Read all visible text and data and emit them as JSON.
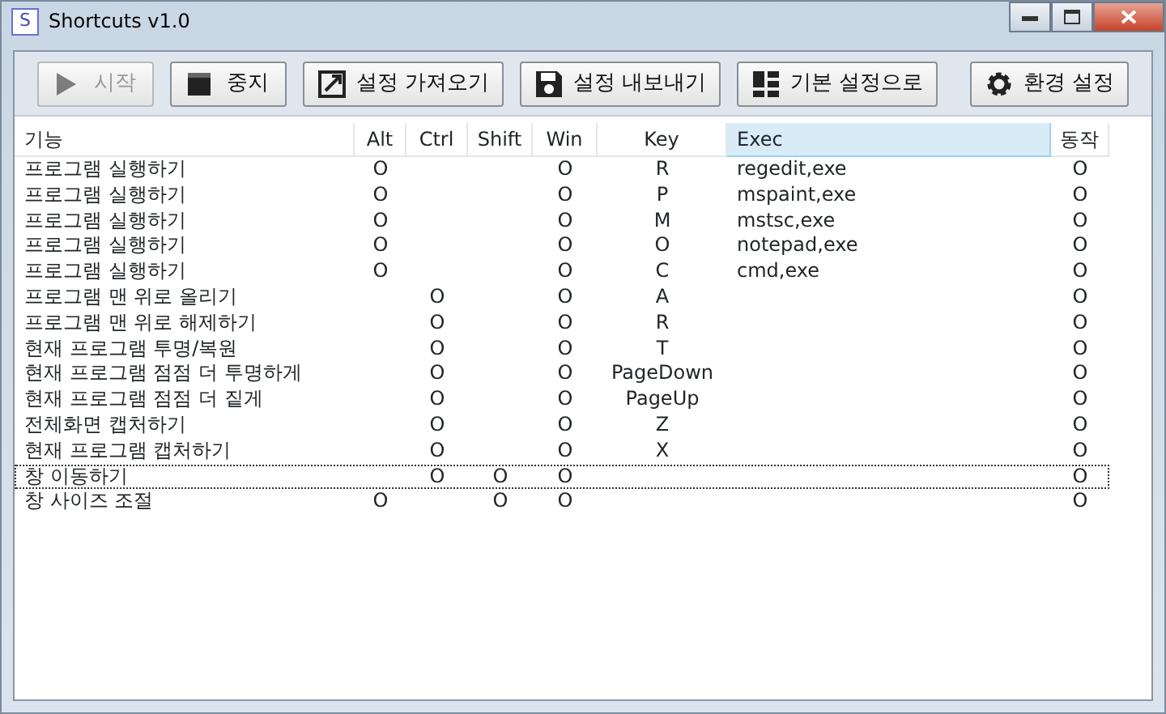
{
  "window": {
    "title": "Shortcuts v1.0",
    "icon_letter": "S"
  },
  "toolbar": [
    {
      "kind": "play",
      "label": "시작",
      "disabled": true
    },
    {
      "kind": "stop",
      "label": "중지",
      "disabled": false
    },
    {
      "kind": "import",
      "label": "설정 가져오기",
      "disabled": false
    },
    {
      "kind": "save",
      "label": "설정 내보내기",
      "disabled": false
    },
    {
      "kind": "grid",
      "label": "기본 설정으로",
      "disabled": false
    },
    {
      "kind": "gear",
      "label": "환경 설정",
      "disabled": false
    }
  ],
  "table": {
    "columns": [
      {
        "label": "기능",
        "highlighted": false
      },
      {
        "label": "Alt",
        "highlighted": false
      },
      {
        "label": "Ctrl",
        "highlighted": false
      },
      {
        "label": "Shift",
        "highlighted": false
      },
      {
        "label": "Win",
        "highlighted": false
      },
      {
        "label": "Key",
        "highlighted": false
      },
      {
        "label": "Exec",
        "highlighted": true
      },
      {
        "label": "동작",
        "highlighted": false
      }
    ],
    "rows": [
      {
        "cells": [
          "프로그램 실행하기",
          "O",
          "",
          "",
          "O",
          "R",
          "regedit,exe",
          "O"
        ],
        "selected": false
      },
      {
        "cells": [
          "프로그램 실행하기",
          "O",
          "",
          "",
          "O",
          "P",
          "mspaint,exe",
          "O"
        ],
        "selected": false
      },
      {
        "cells": [
          "프로그램 실행하기",
          "O",
          "",
          "",
          "O",
          "M",
          "mstsc,exe",
          "O"
        ],
        "selected": false
      },
      {
        "cells": [
          "프로그램 실행하기",
          "O",
          "",
          "",
          "O",
          "O",
          "notepad,exe",
          "O"
        ],
        "selected": false
      },
      {
        "cells": [
          "프로그램 실행하기",
          "O",
          "",
          "",
          "O",
          "C",
          "cmd,exe",
          "O"
        ],
        "selected": false
      },
      {
        "cells": [
          "프로그램 맨 위로 올리기",
          "",
          "O",
          "",
          "O",
          "A",
          "",
          "O"
        ],
        "selected": false
      },
      {
        "cells": [
          "프로그램 맨 위로 해제하기",
          "",
          "O",
          "",
          "O",
          "R",
          "",
          "O"
        ],
        "selected": false
      },
      {
        "cells": [
          "현재 프로그램 투명/복원",
          "",
          "O",
          "",
          "O",
          "T",
          "",
          "O"
        ],
        "selected": false
      },
      {
        "cells": [
          "현재 프로그램 점점 더 투명하게",
          "",
          "O",
          "",
          "O",
          "PageDown",
          "",
          "O"
        ],
        "selected": false
      },
      {
        "cells": [
          "현재 프로그램 점점 더 짙게",
          "",
          "O",
          "",
          "O",
          "PageUp",
          "",
          "O"
        ],
        "selected": false
      },
      {
        "cells": [
          "전체화면 캡처하기",
          "",
          "O",
          "",
          "O",
          "Z",
          "",
          "O"
        ],
        "selected": false
      },
      {
        "cells": [
          "현재 프로그램 캡처하기",
          "",
          "O",
          "",
          "O",
          "X",
          "",
          "O"
        ],
        "selected": false
      },
      {
        "cells": [
          "창 이동하기",
          "",
          "O",
          "O",
          "O",
          "",
          "",
          "O"
        ],
        "selected": true
      },
      {
        "cells": [
          "창 사이즈 조절",
          "O",
          "",
          "O",
          "O",
          "",
          "",
          "O"
        ],
        "selected": false
      }
    ]
  }
}
